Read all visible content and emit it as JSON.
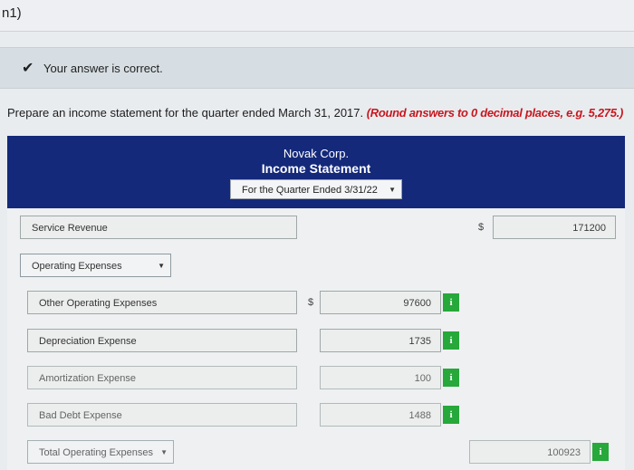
{
  "page": {
    "question_label": "n1)"
  },
  "feedback": {
    "message": "Your answer is correct."
  },
  "instructions": {
    "text": "Prepare an income statement for the quarter ended March 31, 2017.",
    "note": "(Round answers to 0 decimal places, e.g. 5,275.)"
  },
  "statement": {
    "company": "Novak Corp.",
    "title": "Income Statement",
    "period": "For the Quarter Ended 3/31/22"
  },
  "rows": {
    "service_revenue": {
      "label": "Service Revenue",
      "currency": "$",
      "value": "171200"
    },
    "operating_expenses": {
      "label": "Operating Expenses"
    },
    "other_operating": {
      "label": "Other Operating Expenses",
      "currency": "$",
      "value": "97600",
      "info": "i"
    },
    "depreciation": {
      "label": "Depreciation Expense",
      "value": "1735",
      "info": "i"
    },
    "amortization": {
      "label": "Amortization Expense",
      "value": "100",
      "info": "i"
    },
    "bad_debt": {
      "label": "Bad Debt Expense",
      "value": "1488",
      "info": "i"
    },
    "total_operating": {
      "label": "Total Operating Expenses",
      "value": "100923",
      "info": "i"
    }
  },
  "icons": {
    "check": "checkmark-icon",
    "dropdown": "triangle-down-icon",
    "info": "info-icon"
  }
}
